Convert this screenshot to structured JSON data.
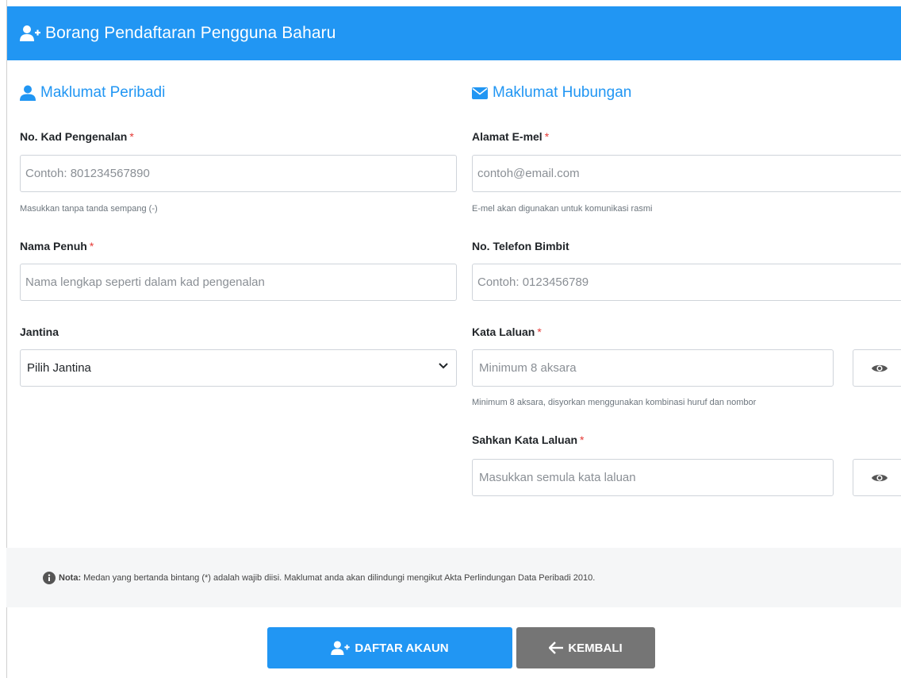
{
  "header": {
    "title": "Borang Pendaftaran Pengguna Baharu",
    "icon": "user-plus-icon"
  },
  "personal": {
    "title": "Maklumat Peribadi",
    "icon": "user-icon",
    "ic": {
      "label": "No. Kad Pengenalan",
      "required": "*",
      "placeholder": "Contoh: 801234567890",
      "value": "",
      "help": "Masukkan tanpa tanda sempang (-)"
    },
    "name": {
      "label": "Nama Penuh",
      "required": "*",
      "placeholder": "Nama lengkap seperti dalam kad pengenalan",
      "value": ""
    },
    "gender": {
      "label": "Jantina",
      "selected": "Pilih Jantina"
    }
  },
  "contact": {
    "title": "Maklumat Hubungan",
    "icon": "envelope-icon",
    "email": {
      "label": "Alamat E-mel",
      "required": "*",
      "placeholder": "contoh@email.com",
      "value": "",
      "help": "E-mel akan digunakan untuk komunikasi rasmi"
    },
    "phone": {
      "label": "No. Telefon Bimbit",
      "placeholder": "Contoh: 0123456789",
      "value": ""
    },
    "password": {
      "label": "Kata Laluan",
      "required": "*",
      "placeholder": "Minimum 8 aksara",
      "value": "",
      "help": "Minimum 8 aksara, disyorkan menggunakan kombinasi huruf dan nombor"
    },
    "confirm": {
      "label": "Sahkan Kata Laluan",
      "required": "*",
      "placeholder": "Masukkan semula kata laluan",
      "value": ""
    }
  },
  "note": {
    "bold": "Nota:",
    "text": "Medan yang bertanda bintang (*) adalah wajib diisi. Maklumat anda akan dilindungi mengikut Akta Perlindungan Data Peribadi 2010."
  },
  "buttons": {
    "register": "DAFTAR AKAUN",
    "back": "KEMBALI"
  },
  "colors": {
    "primary": "#2196f3",
    "secondary": "#757575",
    "required": "#e53935"
  }
}
